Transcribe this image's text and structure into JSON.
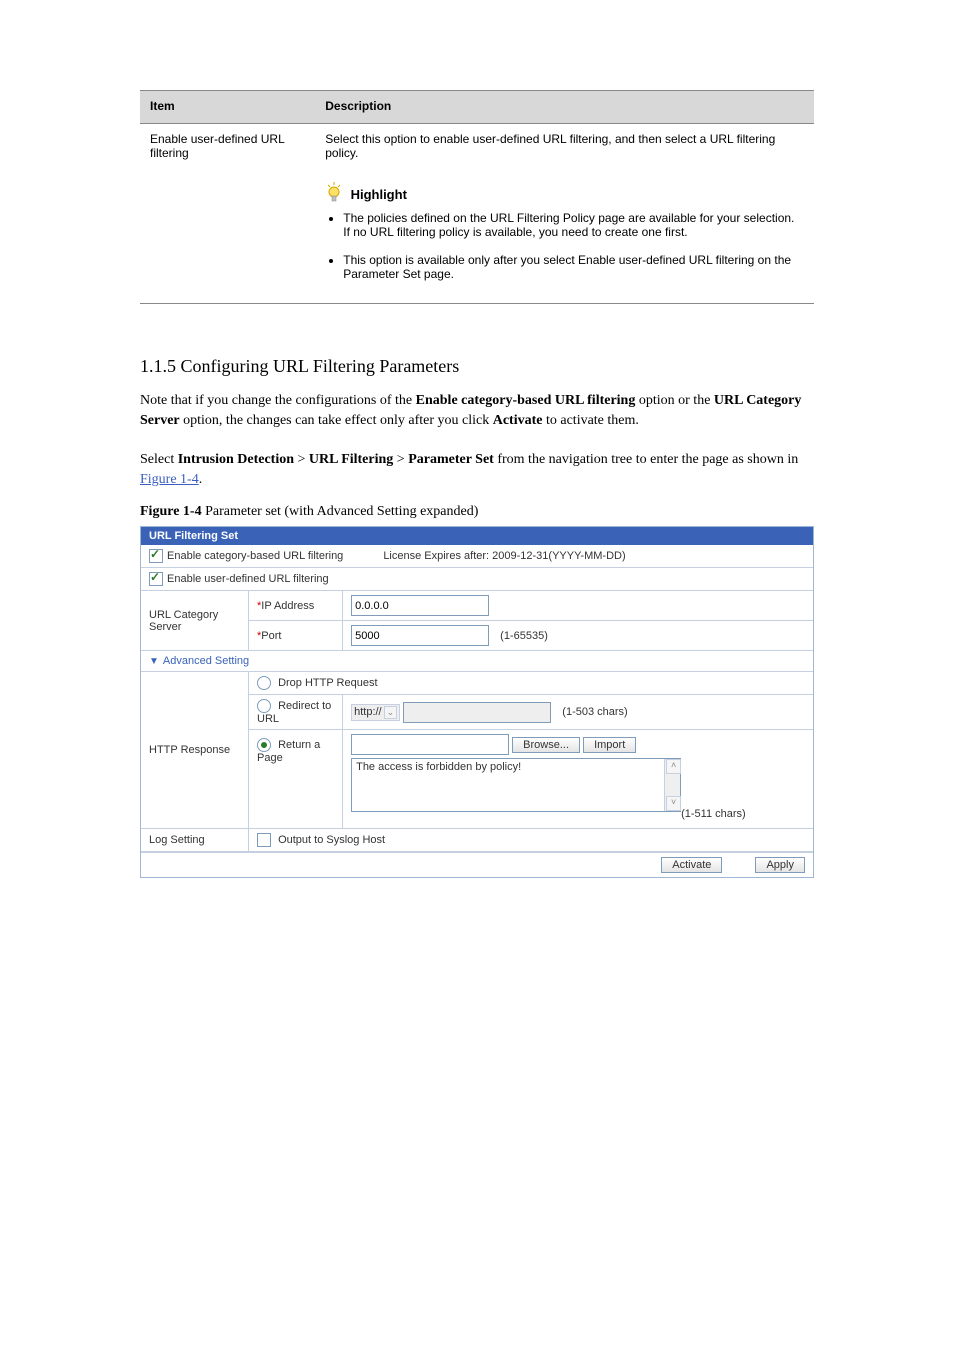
{
  "topTable": {
    "headerLeft": "Item",
    "headerRight": "Description",
    "row1Left": "Enable user-defined URL filtering",
    "row1Right": "Select this option to enable user-defined URL filtering, and then select a URL filtering policy.",
    "row2Right1": "The policies defined on the URL Filtering Policy page are available for your selection. If no URL filtering policy is available, you need to create one first.",
    "row2Right2": "This option is available only after you select Enable user-defined URL filtering on the Parameter Set page."
  },
  "section": {
    "num": "1.1.5",
    "title": "  Configuring URL Filtering Parameters"
  },
  "notes": {
    "p1a": "Note that if you change the configurations of the ",
    "p1b": "Enable category-based URL filtering",
    "p1c": " option or the ",
    "p1d": "URL Category Server",
    "p1e": " option, the changes can take effect only after you click ",
    "p1f": "Activate",
    "p1g": " to activate them.",
    "p2a": "Select ",
    "p2b": "Intrusion Detection",
    "p2c": " > ",
    "p2d": "URL Filtering",
    "p2e": " > ",
    "p2f": "Parameter Set",
    "p2g": " from the navigation tree to enter the page as shown in ",
    "p2link": "Figure 1-4",
    "p2h": "."
  },
  "figcap": {
    "label": "Figure 1-4",
    "text": " Parameter set (with Advanced Setting expanded)"
  },
  "panel": {
    "title": "URL Filtering Set",
    "enableCategory": "Enable category-based URL filtering",
    "license": "License Expires after: 2009-12-31(YYYY-MM-DD)",
    "enableUser": "Enable user-defined URL filtering",
    "urlCatServer": "URL Category Server",
    "ipLabel": "IP Address",
    "ipValue": "0.0.0.0",
    "portLabel": "Port",
    "portValue": "5000",
    "portHint": "(1-65535)",
    "advanced": "Advanced Setting",
    "httpResponse": "HTTP Response",
    "dropHttp": "Drop HTTP Request",
    "redirect": "Redirect to URL",
    "proto": "http://",
    "redirectHint": "(1-503  chars)",
    "returnPage": "Return a Page",
    "browse": "Browse...",
    "import": "Import",
    "pageMsg": "The access is forbidden by policy!",
    "pageHint": "(1-511   chars)",
    "logSetting": "Log Setting",
    "syslog": "Output to Syslog Host",
    "activate": "Activate",
    "apply": "Apply",
    "highlight": "Highlight"
  }
}
